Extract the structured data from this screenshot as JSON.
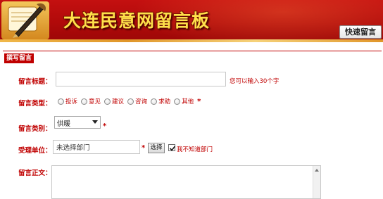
{
  "header": {
    "site_title": "大连民意网留言板",
    "quick_button": "快速留言"
  },
  "section_tag": "撰写留言",
  "form": {
    "title_row": {
      "label": "留言标题：",
      "value": "",
      "hint": "您可以输入30个字"
    },
    "type_row": {
      "label": "留言类型：",
      "options": [
        "投诉",
        "意见",
        "建议",
        "咨询",
        "求助",
        "其他"
      ],
      "required_mark": "*"
    },
    "category_row": {
      "label": "留言类别：",
      "selected": "供暖",
      "required_mark": "*"
    },
    "dept_row": {
      "label": "受理单位：",
      "value": "未选择部门",
      "required_mark": "*",
      "select_button": "选择",
      "checkbox_label": "我不知道部门",
      "checkbox_checked": true
    },
    "body_row": {
      "label": "留言正文：",
      "value": ""
    }
  },
  "colors": {
    "brand_red": "#c00000",
    "header_red": "#b00a0a",
    "title_yellow": "#ffe04a"
  }
}
